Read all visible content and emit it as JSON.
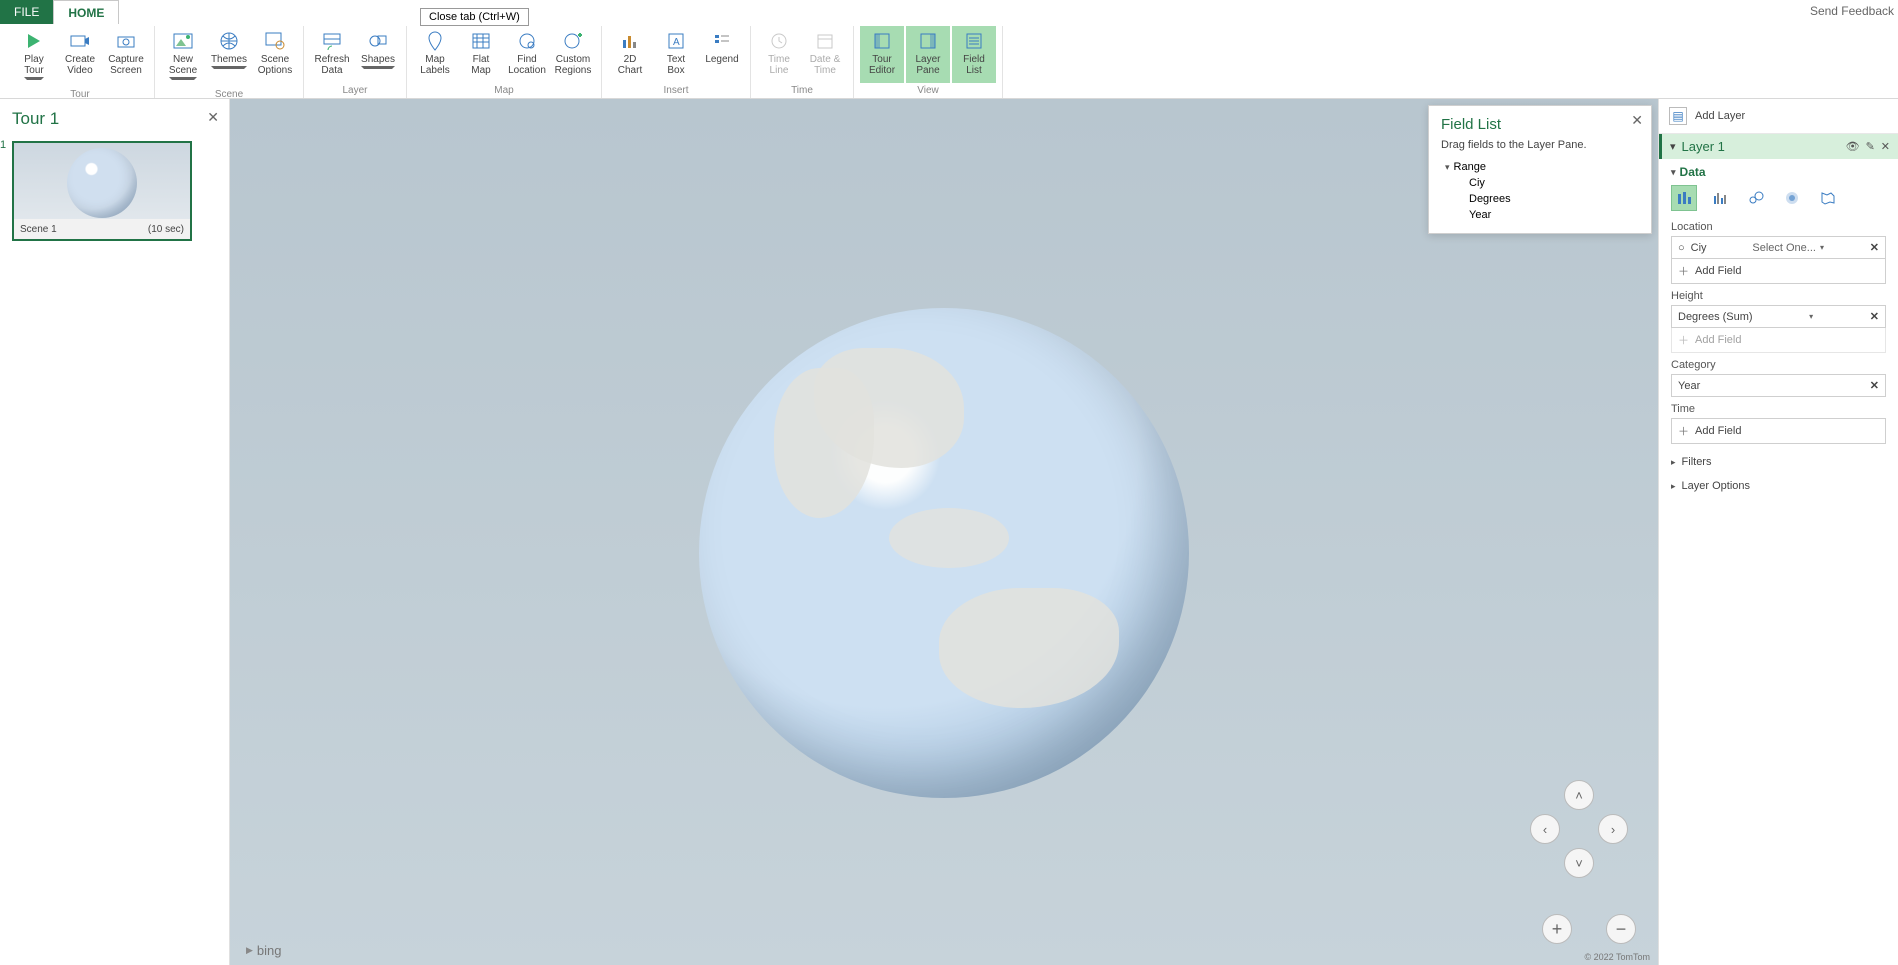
{
  "tabs": {
    "file": "FILE",
    "home": "HOME"
  },
  "close_tip": "Close tab (Ctrl+W)",
  "send_feedback": "Send Feedback",
  "ribbon": {
    "tour": {
      "label": "Tour",
      "play": "Play\nTour",
      "create": "Create\nVideo",
      "capture": "Capture\nScreen"
    },
    "scene": {
      "label": "Scene",
      "new": "New\nScene",
      "themes": "Themes",
      "options": "Scene\nOptions"
    },
    "layer": {
      "label": "Layer",
      "refresh": "Refresh\nData",
      "shapes": "Shapes"
    },
    "map": {
      "label": "Map",
      "labels": "Map\nLabels",
      "flat": "Flat\nMap",
      "find": "Find\nLocation",
      "custom": "Custom\nRegions"
    },
    "insert": {
      "label": "Insert",
      "chart": "2D\nChart",
      "text": "Text\nBox",
      "legend": "Legend"
    },
    "time": {
      "label": "Time",
      "timeline": "Time\nLine",
      "datetime": "Date &\nTime"
    },
    "view": {
      "label": "View",
      "editor": "Tour\nEditor",
      "pane": "Layer\nPane",
      "list": "Field\nList"
    }
  },
  "tour_pane": {
    "title": "Tour 1",
    "scene_index": "1",
    "scene_name": "Scene 1",
    "scene_time": "(10 sec)"
  },
  "map": {
    "bing": "bing",
    "copyright": "© 2022 TomTom"
  },
  "field_list": {
    "title": "Field List",
    "hint": "Drag fields to the Layer Pane.",
    "root": "Range",
    "fields": [
      "Ciy",
      "Degrees",
      "Year"
    ]
  },
  "layer_pane": {
    "add_layer": "Add Layer",
    "layer_name": "Layer 1",
    "data": "Data",
    "location": "Location",
    "location_field": "Ciy",
    "location_select": "Select One...",
    "add_field": "Add Field",
    "height": "Height",
    "height_field": "Degrees (Sum)",
    "category": "Category",
    "category_field": "Year",
    "time": "Time",
    "filters": "Filters",
    "layer_options": "Layer Options"
  }
}
